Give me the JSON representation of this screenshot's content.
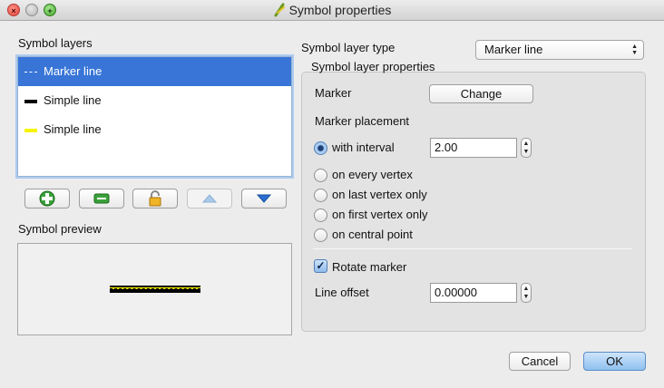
{
  "window": {
    "title": "Symbol properties",
    "controls": [
      "close",
      "minimize",
      "zoom"
    ]
  },
  "left": {
    "layers_label": "Symbol layers",
    "layers": [
      {
        "label": "Marker line",
        "swatch": "dashed-line",
        "selected": true
      },
      {
        "label": "Simple line",
        "swatch": "black-line",
        "selected": false
      },
      {
        "label": "Simple line",
        "swatch": "yellow-line",
        "selected": false
      }
    ],
    "layer_buttons": [
      {
        "icon": "add-layer-icon",
        "enabled": true
      },
      {
        "icon": "remove-layer-icon",
        "enabled": true
      },
      {
        "icon": "lock-icon",
        "enabled": true
      },
      {
        "icon": "move-up-icon",
        "enabled": false
      },
      {
        "icon": "move-down-icon",
        "enabled": true
      }
    ],
    "preview_label": "Symbol preview"
  },
  "right": {
    "layer_type_label": "Symbol layer type",
    "layer_type_value": "Marker line",
    "group_title": "Symbol layer properties",
    "marker_label": "Marker",
    "change_button": "Change",
    "placement_label": "Marker placement",
    "placement_options": [
      {
        "label": "with interval",
        "checked": true
      },
      {
        "label": "on every vertex",
        "checked": false
      },
      {
        "label": "on last vertex only",
        "checked": false
      },
      {
        "label": "on first vertex only",
        "checked": false
      },
      {
        "label": "on central point",
        "checked": false
      }
    ],
    "interval_value": "2.00",
    "rotate_marker_label": "Rotate marker",
    "rotate_marker_checked": true,
    "line_offset_label": "Line offset",
    "line_offset_value": "0.00000"
  },
  "footer": {
    "cancel": "Cancel",
    "ok": "OK"
  },
  "colors": {
    "selection": "#3875d7",
    "yellow_line": "#f5f500"
  }
}
